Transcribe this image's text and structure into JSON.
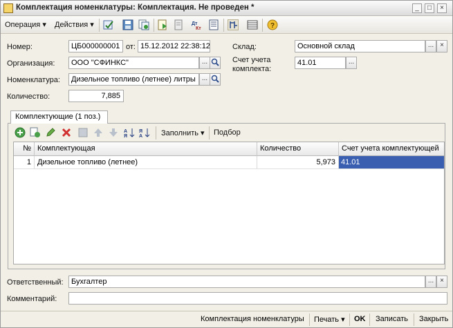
{
  "window": {
    "title": "Комплектация номенклатуры: Комплектация. Не проведен *",
    "min_label": "_",
    "max_label": "□",
    "close_label": "×"
  },
  "toolbar": {
    "operation_label": "Операция ▾",
    "actions_label": "Действия ▾",
    "icons": [
      "post-icon",
      "save-icon",
      "copy-icon",
      "subordinate-icon",
      "movements-icon",
      "dt-kt-icon",
      "report-icon",
      "structure-icon",
      "columns-icon",
      "help-icon"
    ]
  },
  "form": {
    "number_label": "Номер:",
    "number_value": "ЦБ000000001",
    "date_label": "от:",
    "date_value": "15.12.2012 22:38:12",
    "warehouse_label": "Склад:",
    "warehouse_value": "Основной склад",
    "organization_label": "Организация:",
    "organization_value": "ООО \"СФИНКС\"",
    "account_label_1": "Счет учета",
    "account_label_2": "комплекта:",
    "account_value": "41.01",
    "nomenclature_label": "Номенклатура:",
    "nomenclature_value": "Дизельное топливо (летнее) литры",
    "quantity_label": "Количество:",
    "quantity_value": "7,885",
    "ellipsis": "...",
    "clear": "×"
  },
  "tab": {
    "label": "Комплектующие (1 поз.)"
  },
  "grid_toolbar": {
    "fill_label": "Заполнить ▾",
    "pick_label": "Подбор"
  },
  "grid": {
    "columns": [
      "№",
      "Комплектующая",
      "Количество",
      "Счет учета комплектующей"
    ],
    "rows": [
      {
        "n": "1",
        "item": "Дизельное топливо (летнее)",
        "qty": "5,973",
        "account": "41.01"
      }
    ]
  },
  "footer": {
    "responsible_label": "Ответственный:",
    "responsible_value": "Бухгалтер",
    "comment_label": "Комментарий:",
    "comment_value": ""
  },
  "bottombar": {
    "print_form_label": "Комплектация номенклатуры",
    "print_label": "Печать ▾",
    "ok_label": "OK",
    "write_label": "Записать",
    "close_label": "Закрыть"
  }
}
